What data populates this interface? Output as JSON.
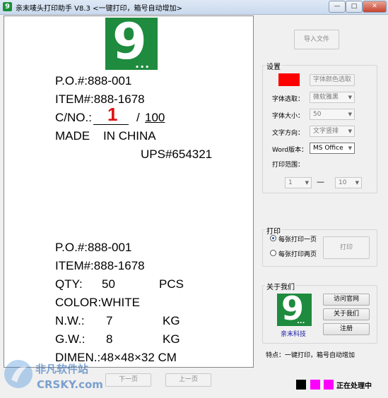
{
  "window": {
    "title": "亲末唛头打印助手 V8.3   <一键打印，箱号自动增加>",
    "minimize": "—",
    "maximize": "□",
    "close": "✕"
  },
  "canvas": {
    "logo_text": "9",
    "logo_dots": "...",
    "label1": {
      "po": "P.O.#:888-001",
      "item": "ITEM#:888-1678",
      "cno_prefix": "C/NO.:",
      "cno_number": "1",
      "cno_sep": "/",
      "cno_total": "100",
      "made": "MADE    IN CHINA",
      "ups": "UPS#654321"
    },
    "label2": {
      "po": "P.O.#:888-001",
      "item": "ITEM#:888-1678",
      "qty_label": "QTY:",
      "qty_value": "50",
      "qty_unit": "PCS",
      "color": "COLOR:WHITE",
      "nw_label": "N.W.:",
      "nw_value": "7",
      "nw_unit": "KG",
      "gw_label": "G.W.:",
      "gw_value": "8",
      "gw_unit": "KG",
      "dimen": "DIMEN.:48×48×32 CM"
    }
  },
  "nav": {
    "next": "下一页",
    "prev": "上一页"
  },
  "right": {
    "import_button": "导入文件",
    "settings": {
      "title": "设置",
      "color_swatch": "#ff0000",
      "font_color_button": "字体颜色选取",
      "font_select_label": "字体选取：",
      "font_select_value": "微软雅黑",
      "font_size_label": "字体大小：",
      "font_size_value": "50",
      "text_dir_label": "文字方向：",
      "text_dir_value": "文字竖排",
      "word_version_label": "Word版本：",
      "word_version_value": "MS Office",
      "print_range_label": "打印范围：",
      "range_from": "1",
      "range_dash": "—",
      "range_to": "10"
    },
    "print": {
      "title": "打印",
      "option1": "每张打印一页",
      "option2": "每张打印两页",
      "print_button": "打印"
    },
    "about": {
      "title": "关于我们",
      "logo_caption": "亲末科技",
      "visit_button": "访问官网",
      "about_button": "关于我们",
      "register_button": "注册"
    },
    "feature_text": "特点：一键打印，箱号自动增加"
  },
  "status": {
    "text": "正在处理中",
    "colors": [
      "#000000",
      "#ff00ff",
      "#ff00ff"
    ]
  },
  "watermark": {
    "line1": "非凡软件站",
    "line2": "CRSKY.com"
  }
}
